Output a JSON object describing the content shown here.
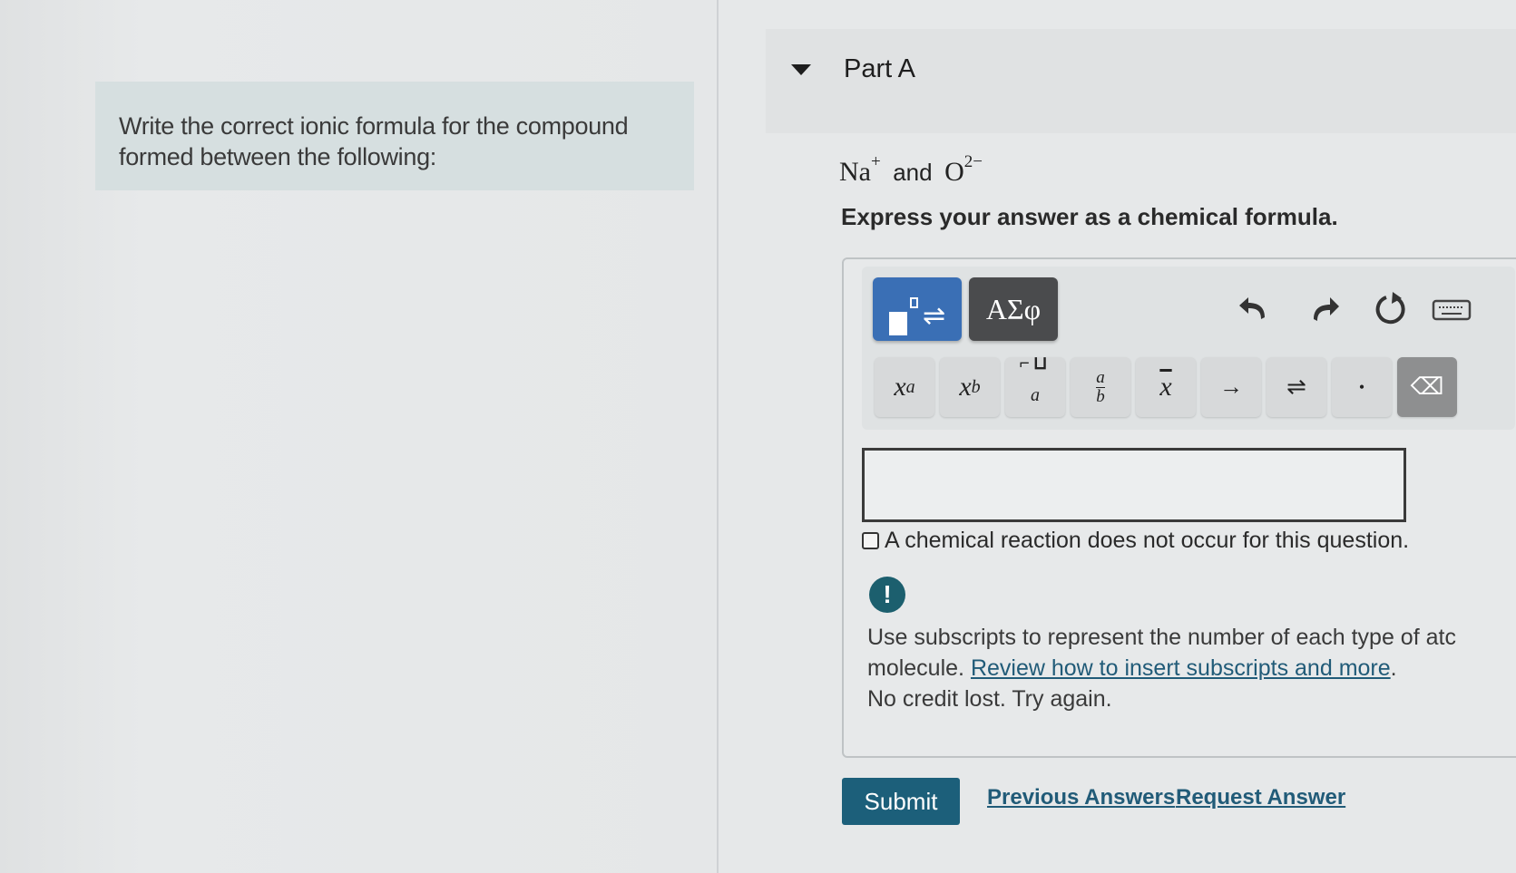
{
  "intro": {
    "text_line1": "Write the correct ionic formula for the compound",
    "text_line2": "formed between the following:"
  },
  "part": {
    "title": "Part A",
    "ion1": "Na",
    "ion1_charge": "+",
    "and_word": "and",
    "ion2": "O",
    "ion2_charge": "2−",
    "instruction": "Express your answer as a chemical formula."
  },
  "toolbar": {
    "template_button": "templates",
    "greek_label": "ΑΣφ",
    "undo_icon": "undo-icon",
    "redo_icon": "redo-icon",
    "reset_icon": "reset-icon",
    "keyboard_icon": "keyboard-icon",
    "keys": {
      "superscript": "x",
      "superscript_sup": "a",
      "subscript": "x",
      "subscript_sub": "b",
      "bracket_a": "a",
      "frac_num": "a",
      "frac_den": "b",
      "overbar": "x",
      "arrow": "→",
      "equilibrium": "⇌",
      "dot": "•",
      "backspace": "⌫"
    }
  },
  "answer": {
    "value": "",
    "no_reaction_label": "A chemical reaction does not occur for this question."
  },
  "feedback": {
    "alert_symbol": "!",
    "line1": "Use subscripts to represent the number of each type of atc",
    "line2_prefix": "molecule. ",
    "line2_link": "Review how to insert subscripts and more",
    "line2_suffix": ".",
    "line3": "No credit lost. Try again."
  },
  "actions": {
    "submit": "Submit",
    "previous_answers": "Previous Answers",
    "request_answer": "Request Answer"
  }
}
